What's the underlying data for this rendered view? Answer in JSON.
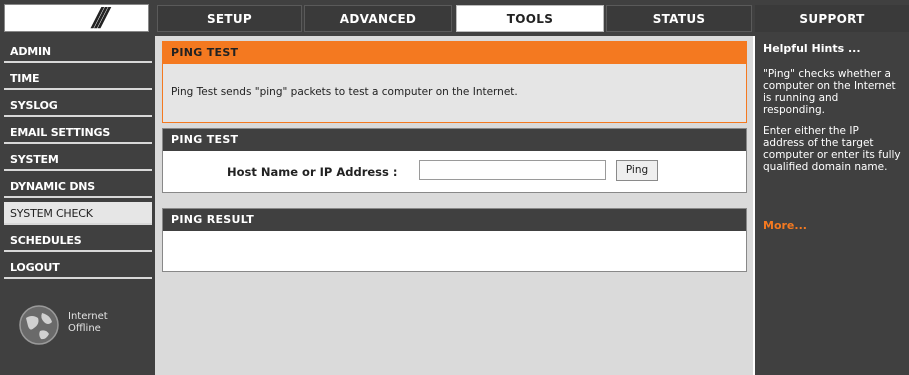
{
  "header": {
    "tabs": [
      {
        "label": "SETUP"
      },
      {
        "label": "ADVANCED"
      },
      {
        "label": "TOOLS"
      },
      {
        "label": "STATUS"
      },
      {
        "label": "SUPPORT"
      }
    ],
    "active_tab": "TOOLS"
  },
  "sidebar": {
    "items": [
      {
        "label": "ADMIN"
      },
      {
        "label": "TIME"
      },
      {
        "label": "SYSLOG"
      },
      {
        "label": "EMAIL SETTINGS"
      },
      {
        "label": "SYSTEM"
      },
      {
        "label": "DYNAMIC DNS"
      },
      {
        "label": "SYSTEM CHECK"
      },
      {
        "label": "SCHEDULES"
      },
      {
        "label": "LOGOUT"
      }
    ],
    "active_item": "SYSTEM CHECK",
    "internet_status": {
      "line1": "Internet",
      "line2": "Offline",
      "icon": "globe-icon"
    }
  },
  "main": {
    "intro": {
      "title": "PING TEST",
      "text": "Ping Test sends \"ping\" packets to test a computer on the Internet."
    },
    "ping_panel": {
      "title": "PING TEST",
      "host_label": "Host Name or IP Address :",
      "host_value": "",
      "button_label": "Ping"
    },
    "result_panel": {
      "title": "PING RESULT"
    }
  },
  "hints": {
    "title": "Helpful Hints ...",
    "p1": "\"Ping\" checks whether a computer on the Internet is running and responding.",
    "p2": "Enter either the IP address of the target computer or enter its fully qualified domain name.",
    "more": "More..."
  },
  "colors": {
    "accent": "#f47920",
    "dark": "#404040",
    "panel_bg": "#dadada"
  }
}
